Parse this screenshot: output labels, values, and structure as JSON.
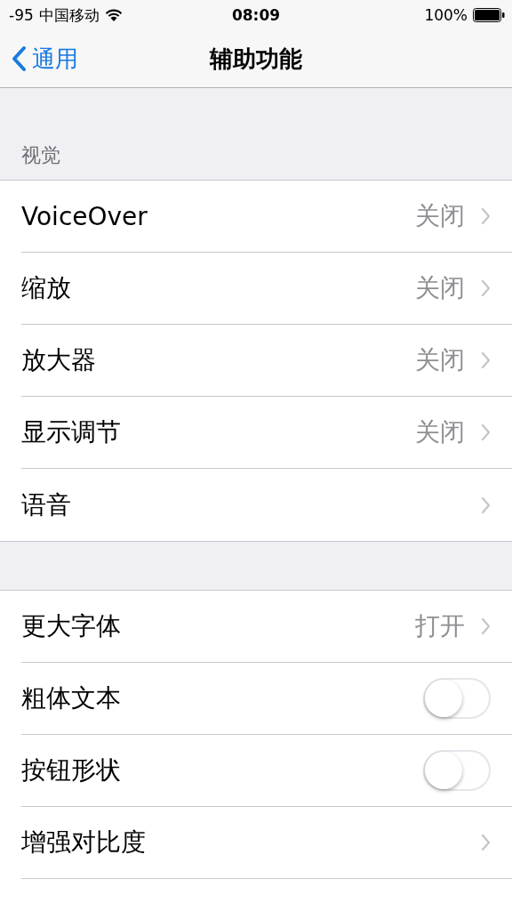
{
  "status_bar": {
    "signal": "-95",
    "carrier": "中国移动",
    "time": "08:09",
    "battery": "100%"
  },
  "nav": {
    "back": "通用",
    "title": "辅助功能"
  },
  "sections": [
    {
      "header": "视觉",
      "rows": [
        {
          "kind": "link",
          "label": "VoiceOver",
          "value": "关闭"
        },
        {
          "kind": "link",
          "label": "缩放",
          "value": "关闭"
        },
        {
          "kind": "link",
          "label": "放大器",
          "value": "关闭"
        },
        {
          "kind": "link",
          "label": "显示调节",
          "value": "关闭"
        },
        {
          "kind": "link",
          "label": "语音"
        }
      ]
    },
    {
      "rows": [
        {
          "kind": "link",
          "label": "更大字体",
          "value": "打开"
        },
        {
          "kind": "toggle",
          "label": "粗体文本",
          "on": false
        },
        {
          "kind": "toggle",
          "label": "按钮形状",
          "on": false
        },
        {
          "kind": "link",
          "label": "增强对比度"
        },
        {
          "kind": "cut"
        }
      ]
    }
  ]
}
